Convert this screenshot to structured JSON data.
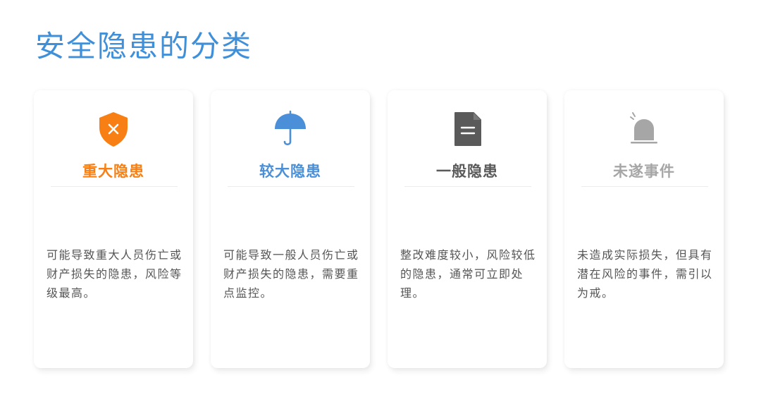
{
  "page": {
    "title": "安全隐患的分类"
  },
  "cards": [
    {
      "title": "重大隐患",
      "description": "可能导致重大人员伤亡或财产损失的隐患，风险等级最高。",
      "icon": "shield-x-icon",
      "color": "#f77f14"
    },
    {
      "title": "较大隐患",
      "description": "可能导致一般人员伤亡或财产损失的隐患，需要重点监控。",
      "icon": "umbrella-icon",
      "color": "#4a8fd8"
    },
    {
      "title": "一般隐患",
      "description": "整改难度较小，风险较低的隐患，通常可立即处理。",
      "icon": "document-icon",
      "color": "#5a5a5a"
    },
    {
      "title": "未遂事件",
      "description": "未造成实际损失，但具有潜在风险的事件，需引以为戒。",
      "icon": "alarm-light-icon",
      "color": "#a6a6a6"
    }
  ]
}
